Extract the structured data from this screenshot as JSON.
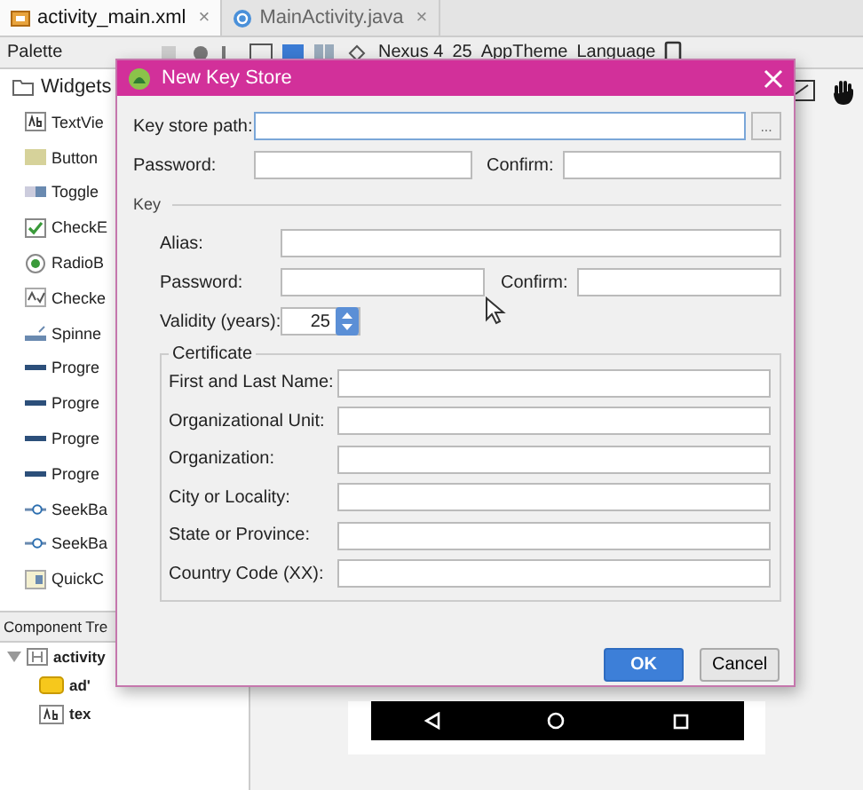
{
  "editor_tabs": [
    {
      "label": "activity_main.xml",
      "selected": true,
      "kind": "xml",
      "close": "×"
    },
    {
      "label": "MainActivity.java",
      "selected": false,
      "kind": "class",
      "close": "×"
    }
  ],
  "toolbar": {
    "title": "Palette",
    "device": "Nexus 4",
    "api": "25",
    "theme": "AppTheme",
    "language": "Language"
  },
  "palette": {
    "group": "Widgets",
    "items": [
      {
        "label": "TextVie",
        "kind": "text"
      },
      {
        "label": "Button",
        "kind": "button"
      },
      {
        "label": "Toggle",
        "kind": "toggle"
      },
      {
        "label": "CheckE",
        "kind": "checkbox"
      },
      {
        "label": "RadioB",
        "kind": "radio"
      },
      {
        "label": "Checke",
        "kind": "checked"
      },
      {
        "label": "Spinne",
        "kind": "spinner"
      },
      {
        "label": "Progre",
        "kind": "progress"
      },
      {
        "label": "Progre",
        "kind": "progress"
      },
      {
        "label": "Progre",
        "kind": "progress"
      },
      {
        "label": "Progre",
        "kind": "progress"
      },
      {
        "label": "SeekBa",
        "kind": "seekbar"
      },
      {
        "label": "SeekBa",
        "kind": "seekbar"
      },
      {
        "label": "QuickC",
        "kind": "quick"
      }
    ]
  },
  "component_tree": {
    "title": "Component Tre",
    "nodes": [
      {
        "label": "activity",
        "kind": "layout",
        "expanded": true,
        "children": [
          {
            "label": "ad'",
            "kind": "ad"
          },
          {
            "label": "tex",
            "kind": "text"
          }
        ]
      }
    ]
  },
  "dialog": {
    "title": "New Key Store",
    "path_label": "Key store path:",
    "browse": "...",
    "password_label": "Password:",
    "confirm_label": "Confirm:",
    "key_section": "Key",
    "key_fields": [
      {
        "label": "Alias:",
        "kind": "wide"
      },
      {
        "label": "Password:",
        "kind": "pair",
        "confirm_label": "Confirm:"
      }
    ],
    "validity": {
      "label": "Validity (years):",
      "value": "25"
    },
    "certificate": {
      "title": "Certificate",
      "fields": [
        "First and Last Name:",
        "Organizational Unit:",
        "Organization:",
        "City or Locality:",
        "State or Province:",
        "Country Code (XX):"
      ]
    },
    "buttons": [
      {
        "label": "OK",
        "kind": "primary"
      },
      {
        "label": "Cancel",
        "kind": "secondary"
      }
    ]
  }
}
